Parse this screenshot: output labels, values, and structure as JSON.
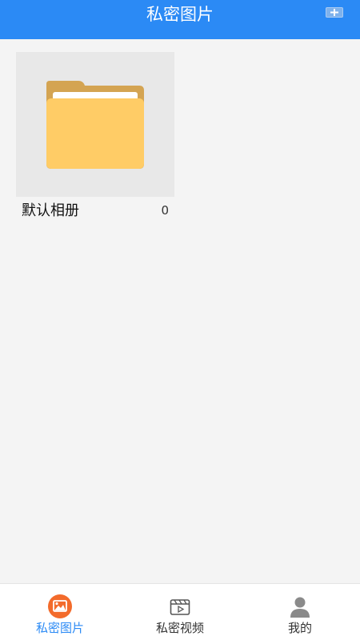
{
  "header": {
    "title": "私密图片",
    "add_icon": "plus-icon"
  },
  "albums": [
    {
      "name": "默认相册",
      "count": "0",
      "icon": "folder-icon"
    }
  ],
  "tabs": [
    {
      "label": "私密图片",
      "icon": "image-icon",
      "active": true
    },
    {
      "label": "私密视频",
      "icon": "video-icon",
      "active": false
    },
    {
      "label": "我的",
      "icon": "person-icon",
      "active": false
    }
  ],
  "colors": {
    "header_bg": "#2b8af5",
    "active_tab": "#2b8af5",
    "active_icon": "#f36b2b",
    "inactive_tab": "#333333",
    "folder": "#ffcc66"
  }
}
